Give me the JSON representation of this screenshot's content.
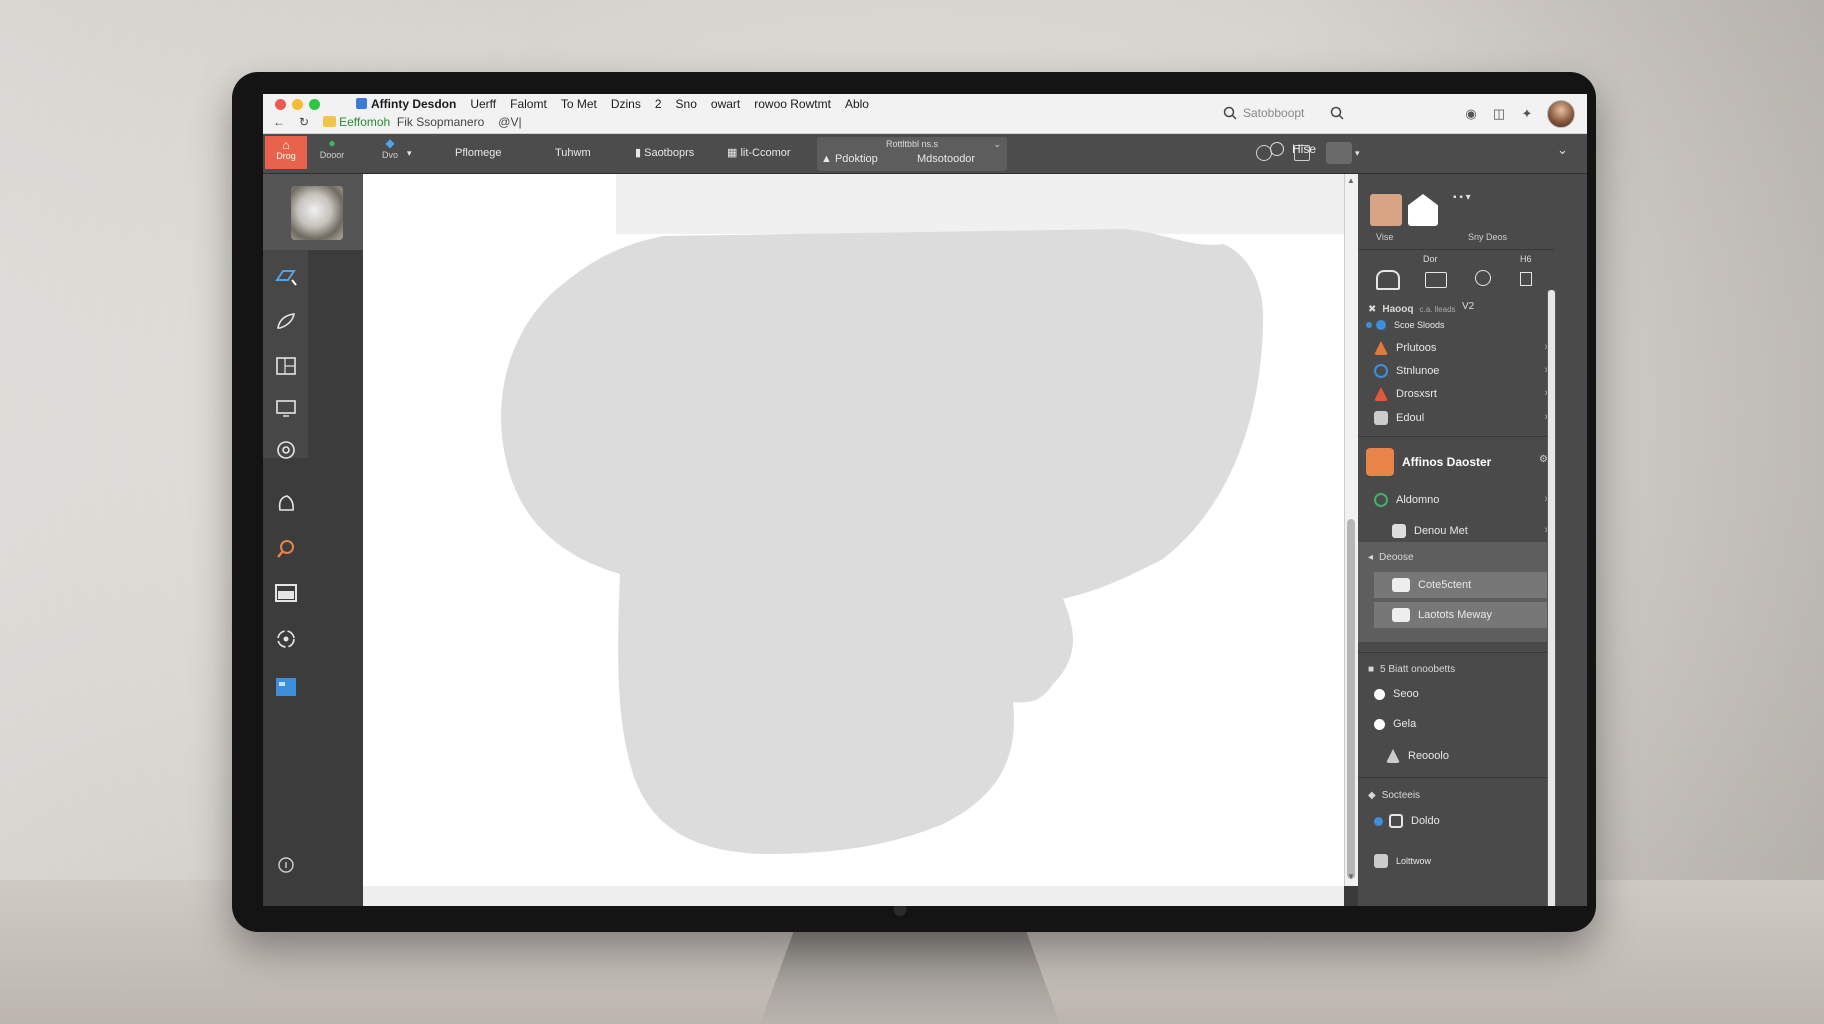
{
  "menubar": {
    "app_name": "Affinty Desdon",
    "items": [
      "Uerff",
      "Falomt",
      "To Met",
      "Dzins",
      "2",
      "Sno",
      "owart",
      "rowoo Rowtmt",
      "Ablo"
    ]
  },
  "navbar": {
    "path_green": "Eeffomoh",
    "path": "Fik Ssopmanero",
    "extra": "@V|"
  },
  "search": {
    "placeholder": "Satobboopt"
  },
  "toolbar": {
    "home_label": "Drog",
    "btn2_label": "Dooor",
    "btn3_label": "Dvo",
    "btn4_label": "Pflomege",
    "btn5_label": "Tuhwm",
    "btn6_label": "Saotboprs",
    "btn7_label": "lit-Ccomor",
    "group_title": "Rottltbbl ns.s",
    "btn8_label": "Pdoktiop",
    "btn9_label": "Mdsotoodor",
    "panel_tab": "Hise"
  },
  "right_panel": {
    "swatch_labels": [
      "Vise",
      "Sny Deos"
    ],
    "tool_header": "Dor",
    "tool_right": "H6",
    "v2_label": "V2",
    "section1_title": "Haooq",
    "section1_sub": "c.a. lleads",
    "section1_items": [
      {
        "label": "Scoe Sloods",
        "color": "#3d8fdb"
      },
      {
        "label": "Prlutoos",
        "color": "#e27a3c"
      },
      {
        "label": "Stnlunoe",
        "color": "#3d8fdb"
      },
      {
        "label": "Drosxsrt",
        "color": "#e25a3c"
      },
      {
        "label": "Edoul",
        "color": "#cccccc"
      }
    ],
    "highlight_title": "Affinos Daoster",
    "highlight_items": [
      {
        "label": "Aldomno",
        "color": "#44b06a"
      },
      {
        "label": "Denou Met",
        "color": "#dddddd"
      }
    ],
    "section2_title": "Deoose",
    "section2_items": [
      "Cote5ctent",
      "Laotots Meway"
    ],
    "section3_title": "5 Biatt onoobetts",
    "section3_items": [
      {
        "label": "Seoo",
        "color": "#ffffff"
      },
      {
        "label": "Gela",
        "color": "#ffffff"
      },
      {
        "label": "Reooolo",
        "color": "#cccccc"
      }
    ],
    "section4_title": "Socteeis",
    "section4_items": [
      {
        "label": "Doldo",
        "color": "#3d8fdb"
      }
    ],
    "cutoff_label": "Lolttwow"
  },
  "colors": {
    "accent": "#e8634a",
    "highlight_bg": "#5e5e5e",
    "panel_bg": "#4a4a4a",
    "canvas_shape": "#dcdcdc"
  }
}
